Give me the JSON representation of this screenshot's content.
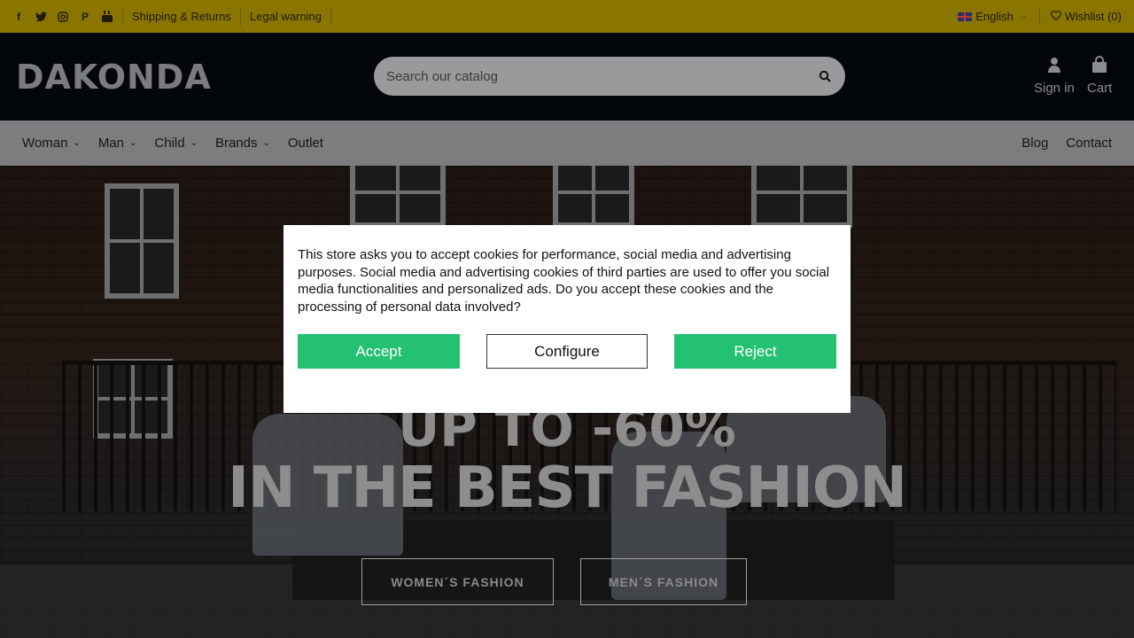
{
  "colors": {
    "topbar_bg": "#8a7500",
    "header_bg": "#03060a",
    "nav_bg": "#7d7d7f",
    "accept_button": "#24c172",
    "reject_button": "#24c172"
  },
  "topbar": {
    "social_icons": [
      "facebook-icon",
      "twitter-icon",
      "instagram-icon",
      "pinterest-icon",
      "youtube-icon"
    ],
    "links": [
      "Shipping & Returns",
      "Legal warning"
    ],
    "language": "English",
    "wishlist": "Wishlist (0)"
  },
  "header": {
    "logo": "DAKONDA",
    "search_placeholder": "Search our catalog",
    "sign_in": "Sign in",
    "cart": "Cart"
  },
  "nav": {
    "items": [
      "Woman",
      "Man",
      "Child",
      "Brands",
      "Outlet"
    ],
    "right_items": [
      "Blog",
      "Contact"
    ]
  },
  "hero": {
    "line1": "UP TO -60%",
    "line2": "IN THE BEST FASHION",
    "cta_women": "WOMEN´S FASHION",
    "cta_men": "MEN´S FASHION"
  },
  "cookie_modal": {
    "text": "This store asks you to accept cookies for performance, social media and advertising purposes. Social media and advertising cookies of third parties are used to offer you social media functionalities and personalized ads. Do you accept these cookies and the processing of personal data involved?",
    "accept": "Accept",
    "configure": "Configure",
    "reject": "Reject"
  }
}
